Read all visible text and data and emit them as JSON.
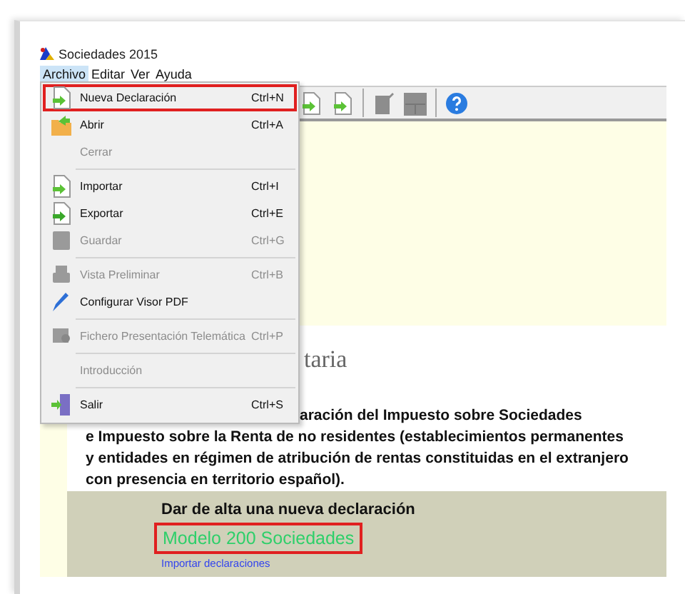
{
  "window": {
    "title": "Sociedades 2015"
  },
  "menubar": [
    {
      "label": "Archivo",
      "selected": true
    },
    {
      "label": "Editar",
      "selected": false
    },
    {
      "label": "Ver",
      "selected": false
    },
    {
      "label": "Ayuda",
      "selected": false
    }
  ],
  "file_menu": [
    {
      "kind": "item",
      "label": "Nueva Declaración",
      "shortcut": "Ctrl+N",
      "disabled": false,
      "highlighted": true
    },
    {
      "kind": "item",
      "label": "Abrir",
      "shortcut": "Ctrl+A",
      "disabled": false,
      "highlighted": false
    },
    {
      "kind": "item",
      "label": "Cerrar",
      "disabled": true,
      "highlighted": false
    },
    {
      "kind": "separator"
    },
    {
      "kind": "item",
      "label": "Importar",
      "shortcut": "Ctrl+I",
      "disabled": false,
      "highlighted": false
    },
    {
      "kind": "item",
      "label": "Exportar",
      "shortcut": "Ctrl+E",
      "disabled": false,
      "highlighted": false
    },
    {
      "kind": "item",
      "label": "Guardar",
      "shortcut": "Ctrl+G",
      "disabled": true,
      "highlighted": false
    },
    {
      "kind": "separator"
    },
    {
      "kind": "item",
      "label": "Vista Preliminar",
      "shortcut": "Ctrl+B",
      "disabled": true,
      "highlighted": false
    },
    {
      "kind": "item",
      "label": "Configurar Visor PDF",
      "disabled": false,
      "highlighted": false
    },
    {
      "kind": "separator"
    },
    {
      "kind": "item",
      "label": "Fichero Presentación Telemática",
      "shortcut": "Ctrl+P",
      "disabled": true,
      "highlighted": false
    },
    {
      "kind": "separator"
    },
    {
      "kind": "item",
      "label": "Introducción",
      "disabled": true,
      "highlighted": false
    },
    {
      "kind": "separator"
    },
    {
      "kind": "item",
      "label": "Salir",
      "shortcut": "Ctrl+S",
      "disabled": false,
      "highlighted": false
    }
  ],
  "content": {
    "heading": "taria",
    "description_lines": [
      "aración del Impuesto sobre Sociedades",
      "e Impuesto sobre la Renta de no residentes (establecimientos permanentes",
      "y entidades en régimen de atribución de rentas constituidas en el extranjero",
      "con presencia en territorio español)."
    ],
    "new_declaration": {
      "title": "Dar de alta una nueva declaración",
      "model_link": {
        "label": "Modelo 200 Sociedades",
        "highlighted": true
      },
      "import_link": "Importar declaraciones"
    }
  }
}
